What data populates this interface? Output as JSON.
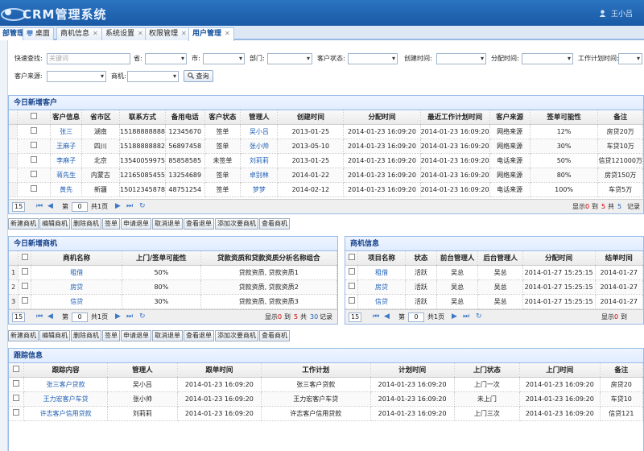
{
  "app": {
    "title": "CRM管理系统",
    "user": "王小吕",
    "strip_text": "部管理"
  },
  "tabs": [
    {
      "label": "桌面",
      "closable": false
    },
    {
      "label": "商机信息",
      "closable": true
    },
    {
      "label": "系统设置",
      "closable": true
    },
    {
      "label": "权限管理",
      "closable": true
    },
    {
      "label": "用户管理",
      "closable": true
    }
  ],
  "search": {
    "quick_label": "快速查找:",
    "quick_placeholder": "关键词",
    "province_label": "省:",
    "city_label": "市:",
    "dept_label": "部门:",
    "status_label": "客户状态:",
    "created_label": "创建时间:",
    "assigned_label": "分配时间:",
    "plan_label": "工作计划时间:",
    "source_label": "客户来源:",
    "opp_label": "商机:",
    "button": "查询"
  },
  "customers": {
    "title": "今日新增客户",
    "columns": [
      "客户信息",
      "省市区",
      "联系方式",
      "备用电话",
      "客户状态",
      "管理人",
      "创建时间",
      "分配时间",
      "最近工作计划时间",
      "客户来源",
      "签单可能性",
      "备注"
    ],
    "rows": [
      [
        "张三",
        "湖南",
        "15188888888",
        "12345670",
        "签单",
        "吴小吕",
        "2013-01-25",
        "2014-01-23 16:09:20",
        "2014-01-23 16:09:20",
        "网络来源",
        "12%",
        "房贷20万"
      ],
      [
        "王麻子",
        "四川",
        "15188888882",
        "56897458",
        "签单",
        "张小帅",
        "2013-05-10",
        "2014-01-23 16:09:20",
        "2014-01-23 16:09:20",
        "网络来源",
        "30%",
        "车贷10万"
      ],
      [
        "李麻子",
        "北京",
        "13540059975",
        "85858585",
        "未签单",
        "刘莉莉",
        "2013-01-25",
        "2014-01-23 16:09:20",
        "2014-01-23 16:09:20",
        "电话来源",
        "50%",
        "信贷121000万"
      ],
      [
        "蒋先生",
        "内蒙古",
        "12165085455",
        "13254689",
        "签单",
        "卓别林",
        "2014-01-22",
        "2014-01-23 16:09:20",
        "2014-01-23 16:09:20",
        "网络来源",
        "80%",
        "房贷150万"
      ],
      [
        "黄先",
        "新疆",
        "15012345878",
        "48751254",
        "签单",
        "梦梦",
        "2014-02-12",
        "2014-01-23 16:09:20",
        "2014-01-23 16:09:20",
        "电话来源",
        "100%",
        "车贷5万"
      ]
    ],
    "pager": {
      "size": "15",
      "page_prefix": "第",
      "page": "0",
      "page_suffix": "共1页",
      "show": "显示",
      "from": "0",
      "to_label": "到",
      "to": "5",
      "total_label": "共",
      "total": "5",
      "suffix": "记录"
    }
  },
  "toolbar_labels": [
    "新建商机",
    "编辑商机",
    "删除商机",
    "签单",
    "申请退单",
    "取消退单",
    "查看退单",
    "添加次要商机",
    "查看商机"
  ],
  "today_opps": {
    "title": "今日新增商机",
    "columns": [
      "商机名称",
      "上门/签单可能性",
      "贷款资质和贷款资质分析名称组合"
    ],
    "rows": [
      [
        "1",
        "租借",
        "50%",
        "贷款资质, 贷款资质1"
      ],
      [
        "2",
        "房贷",
        "80%",
        "贷款资质, 贷款资质2"
      ],
      [
        "3",
        "信贷",
        "30%",
        "贷款资质, 贷款资质3"
      ]
    ],
    "pager": {
      "size": "15",
      "page_prefix": "第",
      "page": "0",
      "page_suffix": "共1页",
      "show": "显示",
      "from": "0",
      "to_label": "到",
      "to": "5",
      "total_label": "共",
      "total": "30",
      "suffix": "记录"
    }
  },
  "opp_info": {
    "title": "商机信息",
    "columns": [
      "项目名称",
      "状态",
      "前台管理人",
      "后台管理人",
      "分配时间",
      "结单时间"
    ],
    "rows": [
      [
        "租借",
        "活跃",
        "吴总",
        "吴总",
        "2014-01-27 15:25:15",
        "2014-01-27"
      ],
      [
        "房贷",
        "活跃",
        "吴总",
        "吴总",
        "2014-01-27 15:25:15",
        "2014-01-27"
      ],
      [
        "信贷",
        "活跃",
        "吴总",
        "吴总",
        "2014-01-27 15:25:15",
        "2014-01-27"
      ]
    ],
    "pager": {
      "size": "15",
      "page_prefix": "第",
      "page": "0",
      "page_suffix": "共1页",
      "show": "显示",
      "from": "0",
      "to_label": "到"
    }
  },
  "followups": {
    "title": "跟踪信息",
    "columns": [
      "跟踪内容",
      "管理人",
      "跟单时间",
      "工作计划",
      "计划时间",
      "上门状态",
      "上门时间",
      "备注"
    ],
    "rows": [
      [
        "张三客户贷款",
        "吴小吕",
        "2014-01-23 16:09:20",
        "张三客户贷款",
        "2014-01-23 16:09:20",
        "上门一次",
        "2014-01-23 16:09:20",
        "房贷20"
      ],
      [
        "王力宏客户车贷",
        "张小帅",
        "2014-01-23 16:09:20",
        "王力宏客户车贷",
        "2014-01-23 16:09:20",
        "未上门",
        "2014-01-23 16:09:20",
        "车贷10"
      ],
      [
        "许志客户信用贷款",
        "刘莉莉",
        "2014-01-23 16:09:20",
        "许志客户信用贷款",
        "2014-01-23 16:09:20",
        "上门三次",
        "2014-01-23 16:09:20",
        "信贷121"
      ]
    ]
  },
  "colors": {
    "accent": "#1a5aa6",
    "link": "#1e5fb4",
    "panel_border": "#99bbe8"
  }
}
